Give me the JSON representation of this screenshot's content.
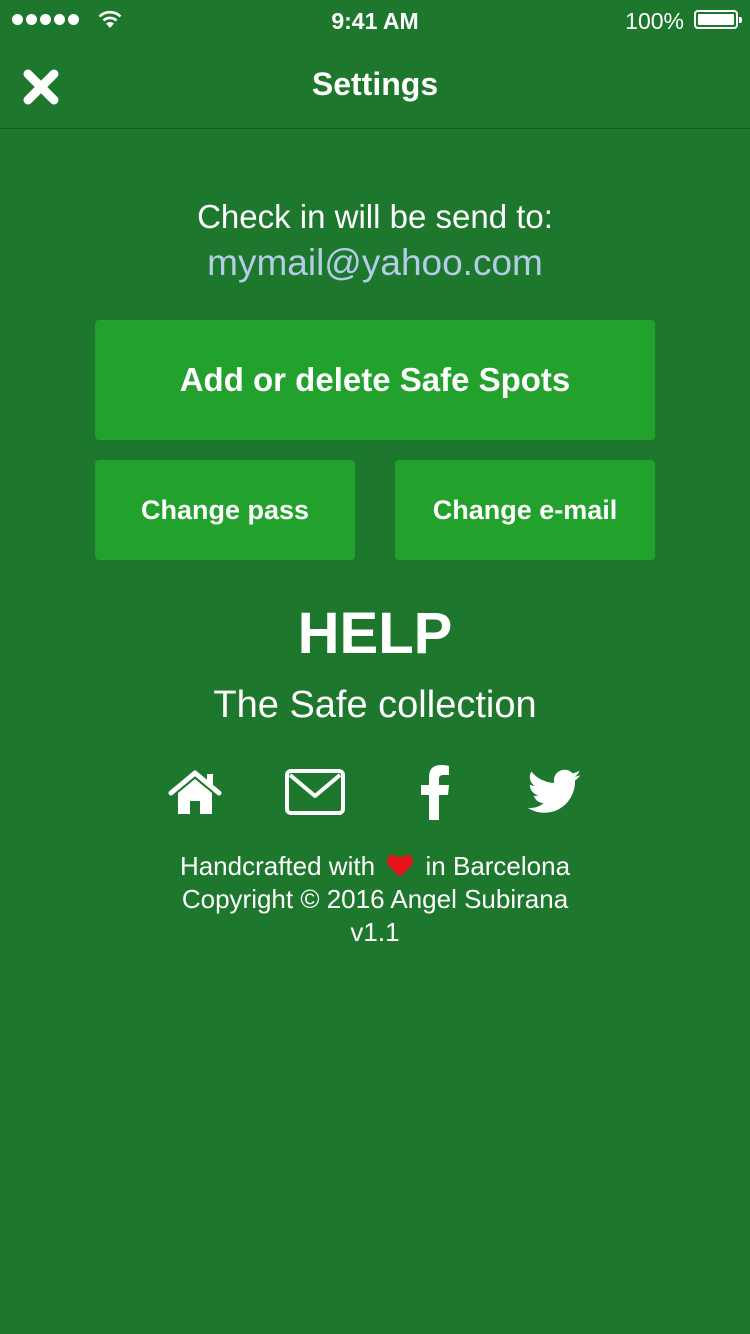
{
  "status_bar": {
    "time": "9:41 AM",
    "battery": "100%"
  },
  "nav": {
    "title": "Settings",
    "close_icon": "close-icon"
  },
  "account": {
    "label": "Check in will be send to:",
    "email": "mymail@yahoo.com"
  },
  "buttons": {
    "safe_spots": "Add or delete Safe Spots",
    "change_pass": "Change pass",
    "change_email": "Change e-mail"
  },
  "help": {
    "title": "HELP",
    "subtitle": "The Safe collection"
  },
  "social": [
    "home-icon",
    "mail-icon",
    "facebook-icon",
    "twitter-icon"
  ],
  "footer": {
    "before_heart": "Handcrafted with",
    "after_heart": "in Barcelona",
    "copyright": "Copyright © 2016 Angel Subirana",
    "version": "v1.1"
  },
  "colors": {
    "background": "#1d772c",
    "button": "#22a22c",
    "email": "#b3cde8",
    "heart": "#e8141b"
  }
}
